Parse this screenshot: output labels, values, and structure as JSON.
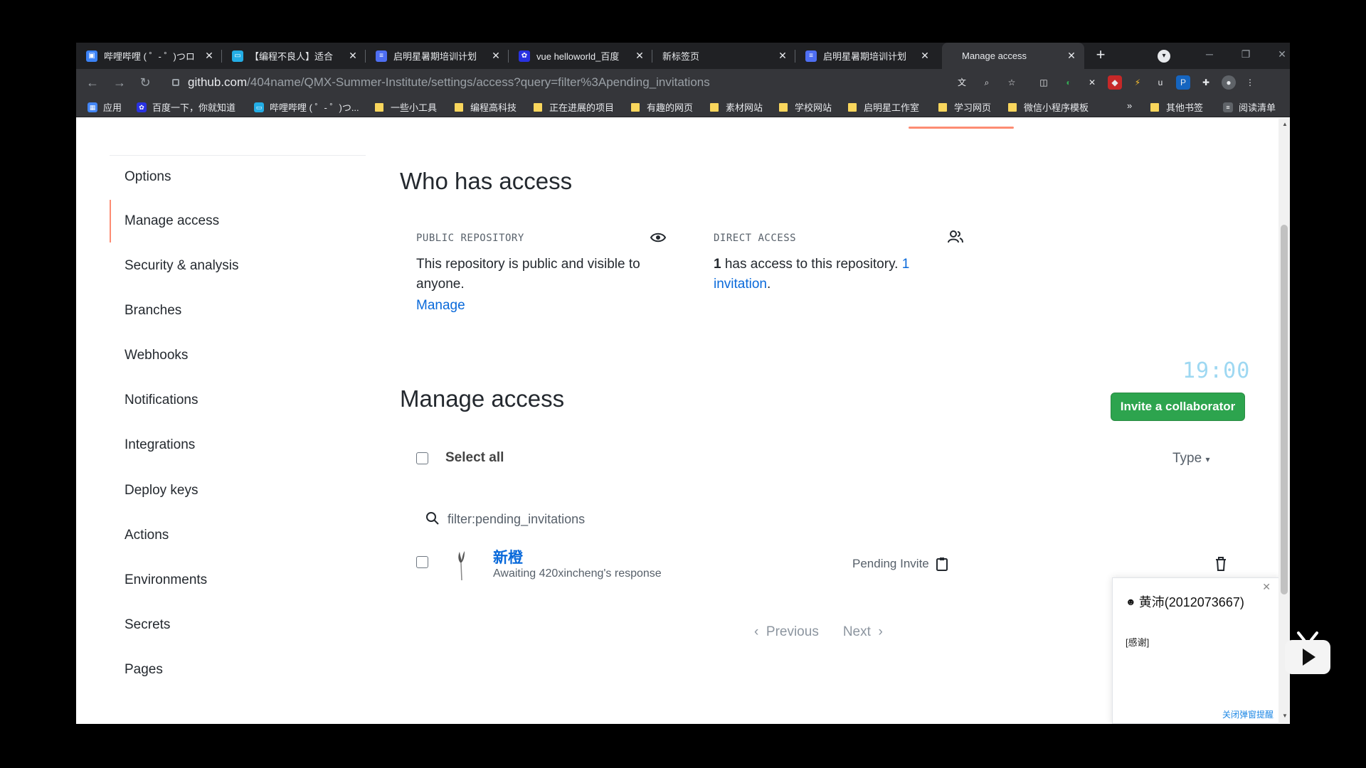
{
  "tabs": [
    {
      "title": "哔哩哔哩 ( ゜- ゜)つロ",
      "favicon_color": "#3b82f6",
      "active": false
    },
    {
      "title": "【编程不良人】适合",
      "favicon_color": "#23ade5",
      "active": false
    },
    {
      "title": "启明星暑期培训计划",
      "favicon_color": "#4e6ef2",
      "active": false
    },
    {
      "title": "vue helloworld_百度",
      "favicon_color": "#2932e1",
      "active": false
    },
    {
      "title": "新标签页",
      "favicon_color": "",
      "active": false
    },
    {
      "title": "启明星暑期培训计划",
      "favicon_color": "#4e6ef2",
      "active": false
    },
    {
      "title": "Manage access",
      "favicon_color": "",
      "active": true
    }
  ],
  "address_bar": {
    "url_host": "github.com",
    "url_path": "/404name/QMX-Summer-Institute/settings/access?query=filter%3Apending_invitations"
  },
  "bookmarks": [
    {
      "label": "应用",
      "type": "apps"
    },
    {
      "label": "百度一下，你就知道",
      "type": "site"
    },
    {
      "label": "哔哩哔哩 ( ゜- ゜)つ...",
      "type": "site"
    },
    {
      "label": "一些小工具",
      "type": "folder"
    },
    {
      "label": "编程高科技",
      "type": "folder"
    },
    {
      "label": "正在进展的项目",
      "type": "folder"
    },
    {
      "label": "有趣的网页",
      "type": "folder"
    },
    {
      "label": "素材网站",
      "type": "folder"
    },
    {
      "label": "学校网站",
      "type": "folder"
    },
    {
      "label": "启明星工作室",
      "type": "folder"
    },
    {
      "label": "学习网页",
      "type": "folder"
    },
    {
      "label": "微信小程序模板",
      "type": "folder"
    },
    {
      "label": "»",
      "type": "more"
    },
    {
      "label": "其他书签",
      "type": "folder"
    },
    {
      "label": "阅读清单",
      "type": "reading"
    }
  ],
  "sidebar": {
    "items": [
      {
        "label": "Options",
        "selected": false
      },
      {
        "label": "Manage access",
        "selected": true
      },
      {
        "label": "Security & analysis",
        "selected": false
      },
      {
        "label": "Branches",
        "selected": false
      },
      {
        "label": "Webhooks",
        "selected": false
      },
      {
        "label": "Notifications",
        "selected": false
      },
      {
        "label": "Integrations",
        "selected": false
      },
      {
        "label": "Deploy keys",
        "selected": false
      },
      {
        "label": "Actions",
        "selected": false
      },
      {
        "label": "Environments",
        "selected": false
      },
      {
        "label": "Secrets",
        "selected": false
      },
      {
        "label": "Pages",
        "selected": false
      }
    ]
  },
  "who_has_access": {
    "title": "Who has access",
    "public": {
      "heading": "PUBLIC REPOSITORY",
      "text": "This repository is public and visible to anyone.",
      "link": "Manage"
    },
    "direct": {
      "heading": "DIRECT ACCESS",
      "count": "1",
      "text_mid": " has access to this repository. ",
      "link": "1 invitation",
      "tail": "."
    }
  },
  "manage_access": {
    "title": "Manage access",
    "invite_button": "Invite a collaborator",
    "select_all": "Select all",
    "type_filter": "Type",
    "search_value": "filter:pending_invitations",
    "members": [
      {
        "name": "新橙",
        "subtitle": "Awaiting 420xincheng's response",
        "status": "Pending Invite"
      }
    ],
    "pagination": {
      "previous": "Previous",
      "next": "Next"
    }
  },
  "overlay_clock": "19:00",
  "popup": {
    "title": "黄沛(2012073667)",
    "body": "[感谢]",
    "footer": "关闭弹窗提醒"
  },
  "colors": {
    "accent": "#fd8c73",
    "link": "#0969da",
    "primary_button": "#2da44e"
  }
}
